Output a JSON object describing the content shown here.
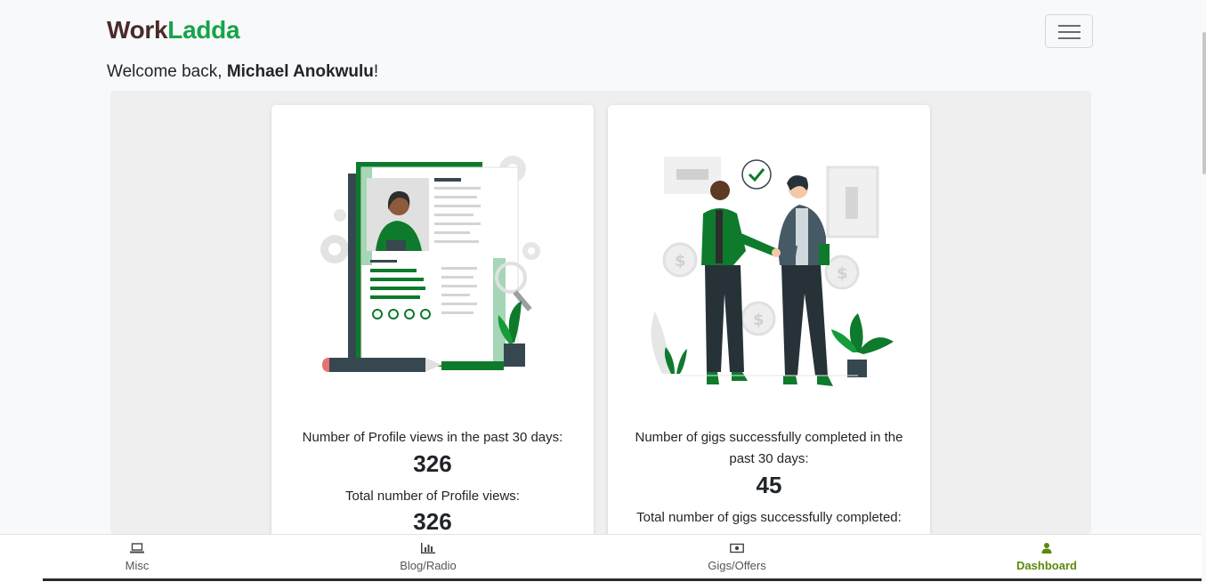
{
  "brand": {
    "part1": "Work",
    "part2": "Ladda"
  },
  "header": {
    "menu_icon": "hamburger-icon"
  },
  "welcome": {
    "prefix": "Welcome back, ",
    "name": "Michael Anokwulu",
    "suffix": "!"
  },
  "cards": [
    {
      "illustration": "resume-illustration",
      "label_recent": "Number of Profile views in the past 30 days:",
      "value_recent": "326",
      "label_total": "Total number of Profile views:",
      "value_total": "326"
    },
    {
      "illustration": "handshake-illustration",
      "label_recent": "Number of gigs successfully completed in the past 30 days:",
      "value_recent": "45",
      "label_total": "Total number of gigs successfully completed:"
    }
  ],
  "bottom_nav": [
    {
      "label": "Misc",
      "icon": "laptop-icon"
    },
    {
      "label": "Blog/Radio",
      "icon": "bar-chart-icon"
    },
    {
      "label": "Gigs/Offers",
      "icon": "money-bill-icon"
    },
    {
      "label": "Dashboard",
      "icon": "user-icon",
      "active": true
    }
  ],
  "colors": {
    "accent": "#17a34a",
    "illustration_green": "#0e7a2c",
    "nav_active": "#5a8a0b"
  }
}
